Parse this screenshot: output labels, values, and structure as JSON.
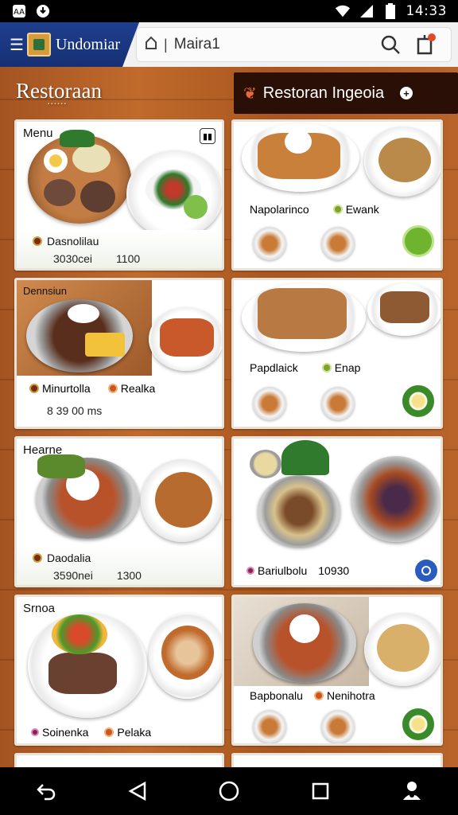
{
  "status_bar": {
    "time": "14:33",
    "left_icons": [
      "android-debug-icon",
      "download-icon"
    ],
    "right_icons": [
      "wifi-icon",
      "signal-icon",
      "battery-icon"
    ]
  },
  "header": {
    "brand_name": "Undomiar",
    "search_text": "Maira1"
  },
  "banner": {
    "logo_text": "Restoraan",
    "title": "Restoran Ingeoia"
  },
  "cards": [
    {
      "label": "Menu",
      "item1": "Dasnolilau",
      "price_a": "3030cei",
      "price_b": "1100"
    },
    {
      "label": "",
      "item1": "Napolarinco",
      "item2": "Ewank"
    },
    {
      "label": "Dennsiun",
      "item1": "Minurtolla",
      "item2": "Realka",
      "price_a": "8 39 00 ms"
    },
    {
      "label": "",
      "item1": "Papdlaick",
      "item2": "Enap"
    },
    {
      "label": "Hearne",
      "item1": "Daodalia",
      "price_a": "3590nei",
      "price_b": "1300"
    },
    {
      "label": "",
      "item1": "Bariulbolu",
      "price_b": "10930"
    },
    {
      "label": "Srnoa",
      "item1": "Soinenka",
      "item2": "Pelaka"
    },
    {
      "label": "",
      "item1": "Bapbonalu",
      "item2": "Nenihotra"
    }
  ],
  "colors": {
    "header_blue": "#1e3e8f",
    "wood": "#b8642a",
    "title_pill": "#2a0f06",
    "accent_green": "#6fb42e",
    "accent_blue": "#2a5bbf"
  },
  "nav": [
    "back-icon",
    "home-triangle-icon",
    "home-circle-icon",
    "recents-icon",
    "accessibility-icon"
  ]
}
